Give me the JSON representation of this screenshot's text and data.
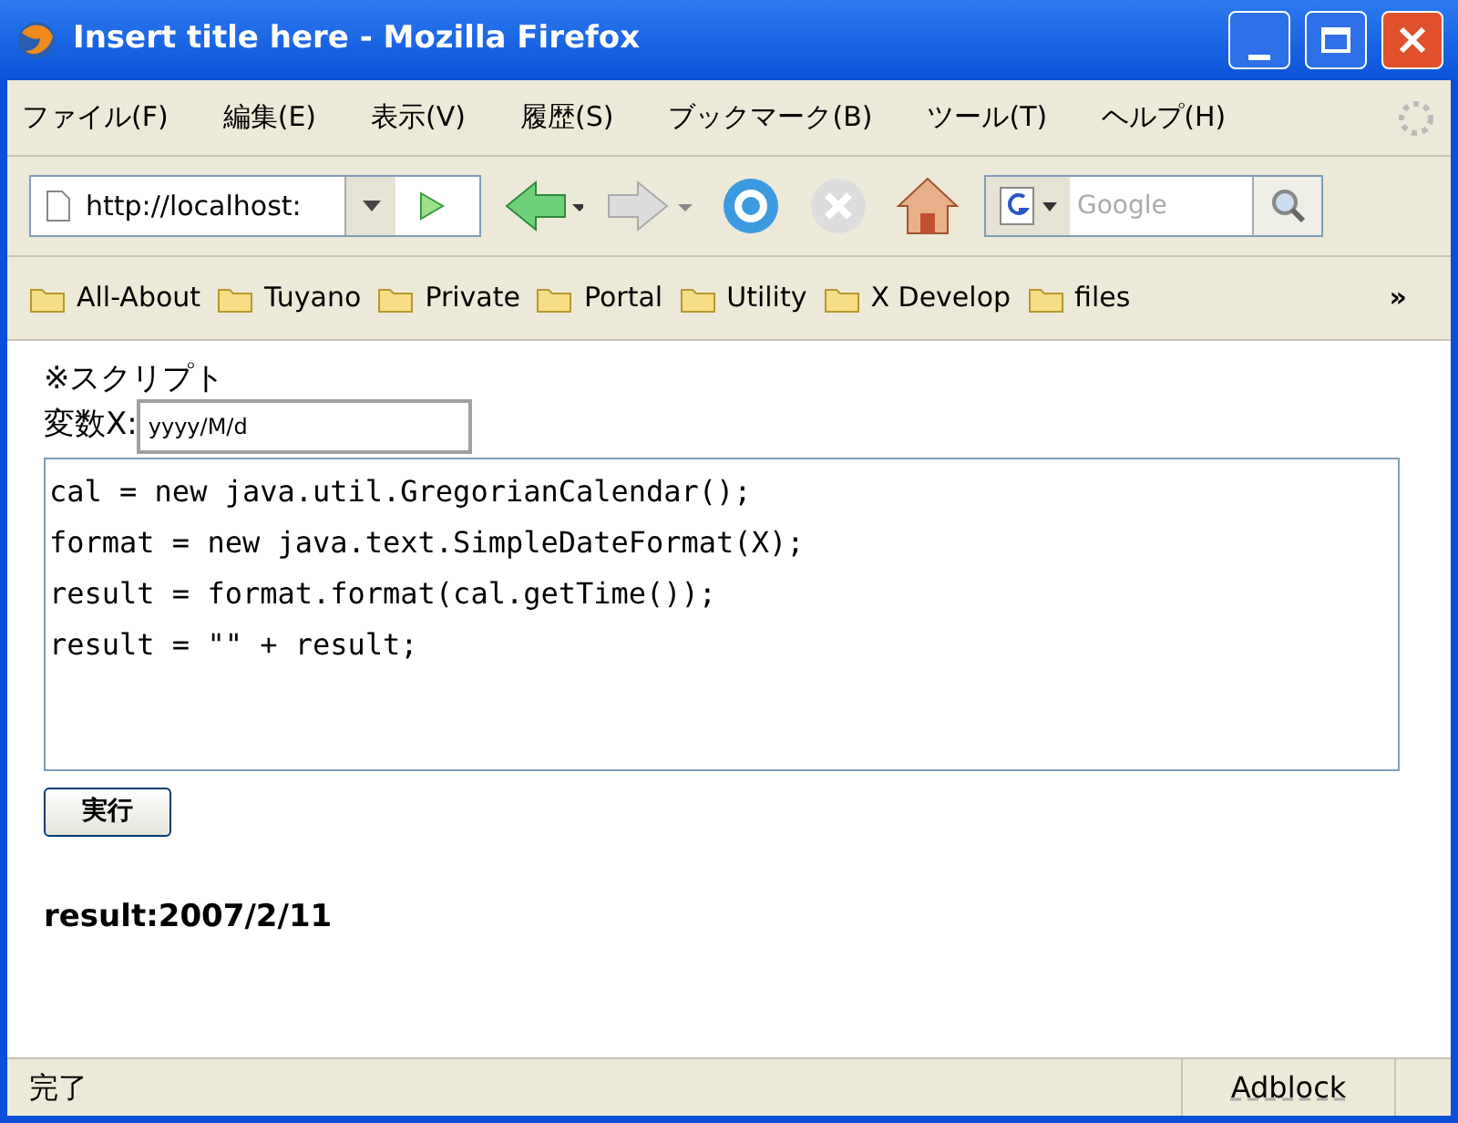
{
  "window": {
    "title": "Insert title here - Mozilla Firefox"
  },
  "menu": [
    "ファイル(F)",
    "編集(E)",
    "表示(V)",
    "履歴(S)",
    "ブックマーク(B)",
    "ツール(T)",
    "ヘルプ(H)"
  ],
  "address": {
    "value": "http://localhost:"
  },
  "search": {
    "placeholder": "Google"
  },
  "bookmarks": [
    "All-About",
    "Tuyano",
    "Private",
    "Portal",
    "Utility",
    "X Develop",
    "files"
  ],
  "bookmarks_more": "»",
  "page": {
    "heading": "※スクリプト",
    "variable_label": "変数X:",
    "variable_value": "yyyy/M/d",
    "code": [
      "cal = new java.util.GregorianCalendar();",
      "format = new java.text.SimpleDateFormat(X);",
      "result = format.format(cal.getTime());",
      "result = \"\" + result;"
    ],
    "run_button": "実行",
    "result": "result:2007/2/11"
  },
  "status_bar": {
    "text": "完了",
    "adblock": "Adblock"
  }
}
